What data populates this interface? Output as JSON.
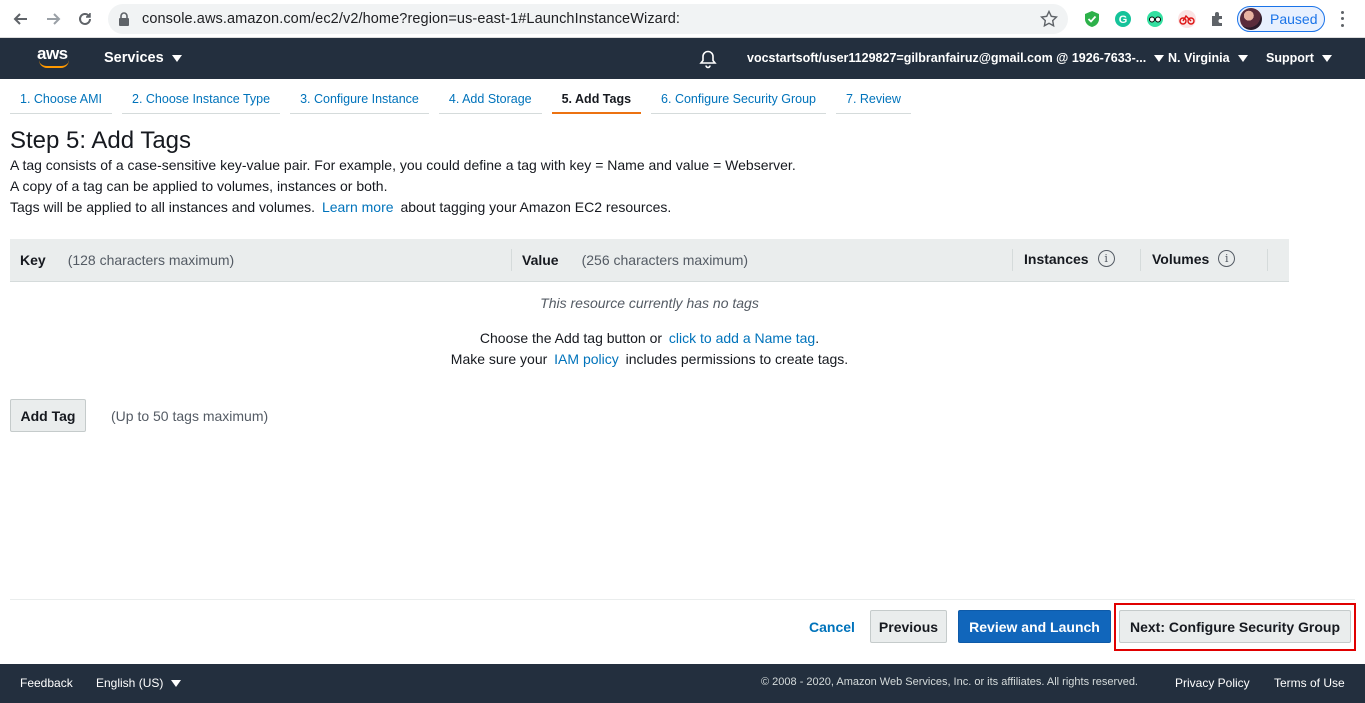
{
  "browser": {
    "url": "console.aws.amazon.com/ec2/v2/home?region=us-east-1#LaunchInstanceWizard:",
    "profile_label": "Paused"
  },
  "topnav": {
    "logo_text": "aws",
    "services_label": "Services",
    "account_label": "vocstartsoft/user1129827=gilbranfairuz@gmail.com @ 1926-7633-...",
    "region_label": "N. Virginia",
    "support_label": "Support"
  },
  "wizard": {
    "steps": [
      {
        "label": "1. Choose AMI"
      },
      {
        "label": "2. Choose Instance Type"
      },
      {
        "label": "3. Configure Instance"
      },
      {
        "label": "4. Add Storage"
      },
      {
        "label": "5. Add Tags"
      },
      {
        "label": "6. Configure Security Group"
      },
      {
        "label": "7. Review"
      }
    ],
    "active_step": "5. Add Tags"
  },
  "page": {
    "title": "Step 5: Add Tags",
    "desc1": "A tag consists of a case-sensitive key-value pair. For example, you could define a tag with key = Name and value = Webserver.",
    "desc2": "A copy of a tag can be applied to volumes, instances or both.",
    "desc3_pre": "Tags will be applied to all instances and volumes.",
    "desc3_link": "Learn more",
    "desc3_post": "about tagging your Amazon EC2 resources."
  },
  "table": {
    "col_key": "Key",
    "col_key_hint": "(128 characters maximum)",
    "col_value": "Value",
    "col_value_hint": "(256 characters maximum)",
    "col_instances": "Instances",
    "col_volumes": "Volumes",
    "empty_text": "This resource currently has no tags",
    "help1_pre": "Choose the Add tag button or",
    "help1_link": "click to add a Name tag",
    "help1_post": ".",
    "help2_pre": "Make sure your",
    "help2_link": "IAM policy",
    "help2_post": "includes permissions to create tags."
  },
  "actions": {
    "add_tag": "Add Tag",
    "add_tag_note": "(Up to 50 tags maximum)",
    "cancel": "Cancel",
    "previous": "Previous",
    "review_launch": "Review and Launch",
    "next": "Next: Configure Security Group"
  },
  "footer": {
    "feedback": "Feedback",
    "language": "English (US)",
    "copyright": "© 2008 - 2020, Amazon Web Services, Inc. or its affiliates. All rights reserved.",
    "privacy": "Privacy Policy",
    "terms": "Terms of Use"
  },
  "colors": {
    "nav_bg": "#232f3e",
    "link": "#0073bb",
    "primary": "#1166bb",
    "active_tab": "#ec7211",
    "highlight": "#e00000"
  }
}
